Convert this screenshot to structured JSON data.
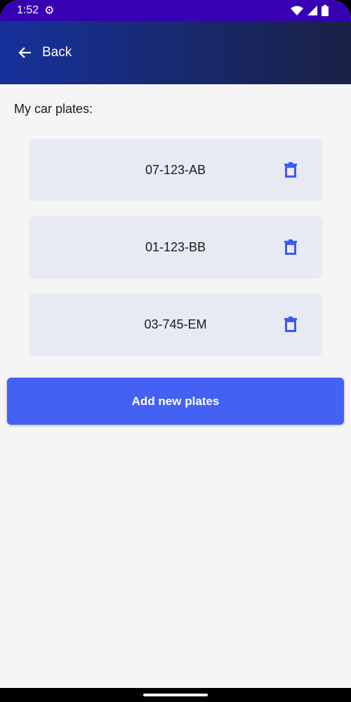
{
  "status_bar": {
    "time": "1:52",
    "icons": [
      "gear-icon",
      "wifi-icon",
      "signal-icon",
      "battery-icon"
    ]
  },
  "app_bar": {
    "back_label": "Back"
  },
  "main": {
    "title": "My car plates:",
    "plates": [
      {
        "number": "07-123-AB"
      },
      {
        "number": "01-123-BB"
      },
      {
        "number": "03-745-EM"
      }
    ],
    "add_label": "Add new plates"
  },
  "colors": {
    "accent": "#4361f3",
    "status_bar": "#3700b3"
  }
}
